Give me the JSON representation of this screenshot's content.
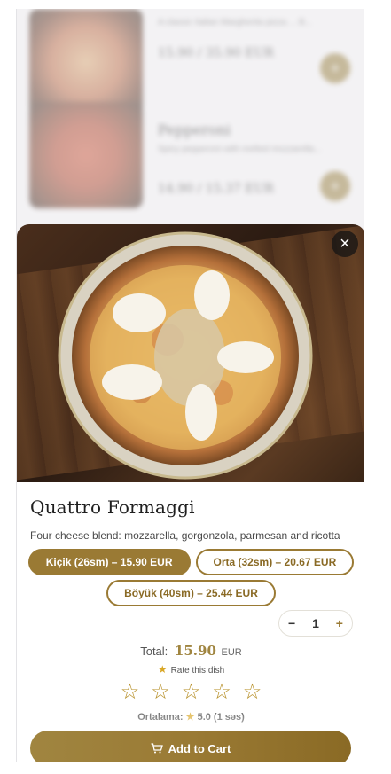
{
  "background_list": {
    "items": [
      {
        "title": "",
        "description": "A classic Italian Margherita pizza ... B...",
        "price": "15.90 / 35.90 EUR"
      },
      {
        "title": "Pepperoni",
        "description": "Spicy pepperoni with melted mozzarella...",
        "price": "14.90 / 15.37 EUR"
      }
    ],
    "add_icon": "plus-icon"
  },
  "modal": {
    "close_icon": "close-icon",
    "close_label": "×",
    "title": "Quattro Formaggi",
    "description": "Four cheese blend: mozzarella, gorgonzola, parmesan and ricotta",
    "sizes": [
      {
        "label": "Kiçik (26sm) – 15.90 EUR",
        "selected": true
      },
      {
        "label": "Orta (32sm) – 20.67 EUR",
        "selected": false
      },
      {
        "label": "Böyük (40sm) – 25.44 EUR",
        "selected": false
      }
    ],
    "quantity": {
      "minus": "−",
      "value": "1",
      "plus": "+"
    },
    "total": {
      "label": "Total:",
      "amount": "15.90",
      "currency": "EUR"
    },
    "rate": {
      "label": "Rate this dish",
      "star_glyph": "★"
    },
    "rating_stars": {
      "empty_glyph": "☆",
      "count": 5
    },
    "average": {
      "label": "Ortalama:",
      "star_glyph": "★",
      "value": "5.0 (1 səs)"
    },
    "cart": {
      "icon": "cart-icon",
      "label": "Add to Cart"
    }
  },
  "colors": {
    "accent": "#9a7a34",
    "accent_light": "#a08540",
    "star": "#d9a726"
  }
}
